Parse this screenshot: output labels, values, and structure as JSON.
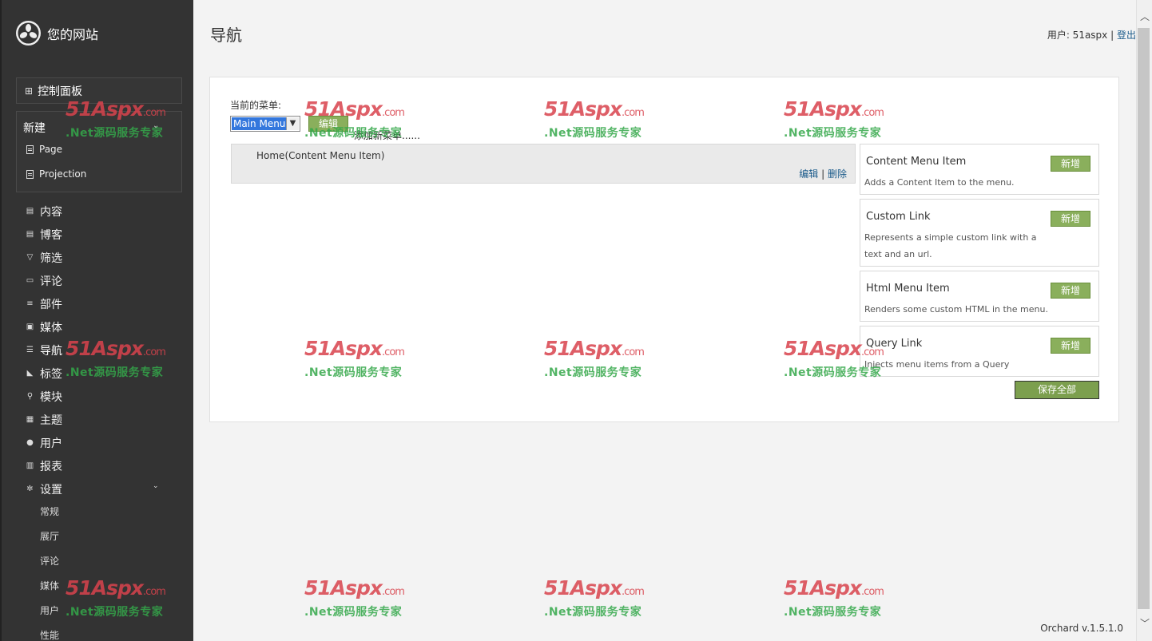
{
  "brand": {
    "site_name": "您的网站"
  },
  "sidebar": {
    "dashboard": "控制面板",
    "new_section": {
      "label": "新建",
      "items": [
        "Page",
        "Projection"
      ]
    },
    "items": [
      {
        "label": "内容",
        "icon": "doc-icon"
      },
      {
        "label": "博客",
        "icon": "doc-icon"
      },
      {
        "label": "筛选",
        "icon": "filter-icon"
      },
      {
        "label": "评论",
        "icon": "comment-icon"
      },
      {
        "label": "部件",
        "icon": "widget-icon"
      },
      {
        "label": "媒体",
        "icon": "media-icon"
      },
      {
        "label": "导航",
        "icon": "nav-icon"
      },
      {
        "label": "标签",
        "icon": "tag-icon"
      },
      {
        "label": "模块",
        "icon": "module-icon"
      },
      {
        "label": "主题",
        "icon": "theme-icon"
      },
      {
        "label": "用户",
        "icon": "user-icon"
      },
      {
        "label": "报表",
        "icon": "report-icon"
      },
      {
        "label": "设置",
        "icon": "gear-icon"
      }
    ],
    "settings_sub": [
      "常规",
      "展厅",
      "评论",
      "媒体",
      "用户",
      "性能"
    ]
  },
  "header": {
    "title": "导航",
    "user_prefix": "用户: 51aspx",
    "separator": "|",
    "logout": "登出"
  },
  "menu_panel": {
    "current_label": "当前的菜单:",
    "selected_menu": "Main Menu",
    "edit_button": "编辑",
    "add_menu": "添加新菜单......",
    "menu_item": "Home(Content Menu Item)",
    "item_edit": "编辑",
    "item_sep": "|",
    "item_delete": "删除"
  },
  "cards": [
    {
      "title": "Content Menu Item",
      "desc": "Adds a Content Item to the menu.",
      "button": "新增"
    },
    {
      "title": "Custom Link",
      "desc": "Represents a simple custom link with a text and an url.",
      "button": "新增"
    },
    {
      "title": "Html Menu Item",
      "desc": "Renders some custom HTML in the menu.",
      "button": "新增"
    },
    {
      "title": "Query Link",
      "desc": "Injects menu items from a Query",
      "button": "新增"
    }
  ],
  "save_all": "保存全部",
  "version": "Orchard v.1.5.1.0",
  "watermark": {
    "logo": "51Aspx",
    "domain": ".com",
    "tagline": ".Net源码服务专家"
  },
  "colors": {
    "sidebar_bg": "#333333",
    "button_green": "#8aaf5c",
    "link_blue": "#1a5a8a",
    "select_highlight": "#3377dd"
  }
}
